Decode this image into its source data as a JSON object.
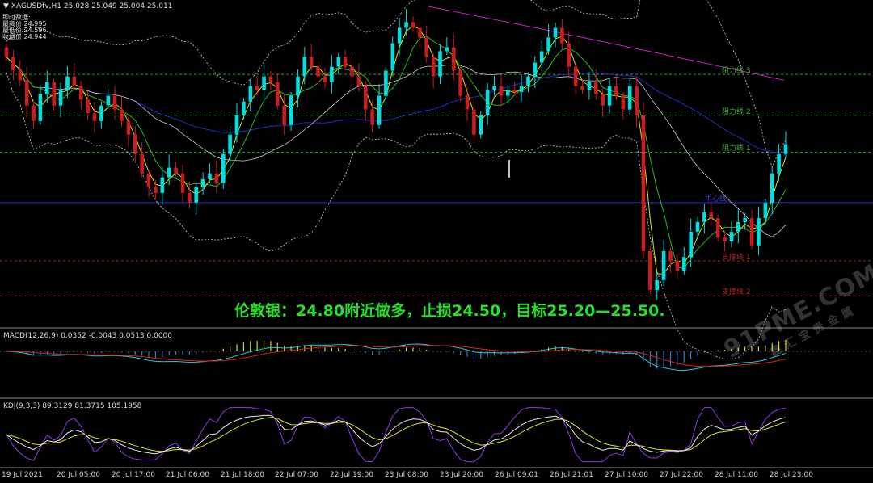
{
  "header": {
    "symbol_line": "XAGUSDfv,H1  25.028 25.049 25.004 25.011",
    "info_title": "即时数据:",
    "info_lines": [
      "最高价 24.995",
      "最低价 24.596",
      "收盘价 24.944"
    ]
  },
  "annotation": "伦敦银：24.80附近做多，止损24.50，目标25.20—25.50.",
  "levels": [
    {
      "label": "阻力线 3",
      "price": 25.46,
      "color": "#2fa82f"
    },
    {
      "label": "阻力线 2",
      "price": 25.25,
      "color": "#2fa82f"
    },
    {
      "label": "阻力线 1",
      "price": 25.06,
      "color": "#2fa82f"
    },
    {
      "label": "支撑线 1",
      "price": 24.5,
      "color": "#b22222"
    },
    {
      "label": "支撑线 2",
      "price": 24.32,
      "color": "#b22222"
    }
  ],
  "pivot": {
    "label": "中心线",
    "price": 24.8,
    "color": "#1f2fd8"
  },
  "macd": {
    "label": "MACD(12,26,9) 0.0352 -0.0043 0.0513 0.0000"
  },
  "kdj": {
    "label": "KDJ(9,3,3) 89.3129 81.3715 105.1958"
  },
  "time_axis": [
    "19 Jul 2021",
    "20 Jul 05:00",
    "20 Jul 17:00",
    "21 Jul 06:00",
    "21 Jul 18:00",
    "22 Jul 07:00",
    "22 Jul 19:00",
    "23 Jul 08:00",
    "23 Jul 20:00",
    "26 Jul 09:01",
    "26 Jul 21:01",
    "27 Jul 10:00",
    "27 Jul 22:00",
    "28 Jul 11:00",
    "28 Jul 23:00"
  ],
  "watermark": {
    "big": "91PME.COM",
    "small": "鑫汇宝贵金属"
  },
  "colors": {
    "bull": "#00e0e0",
    "bear": "#c81e1e",
    "ma_fast": "#e0e000",
    "ma_mid": "#22bb22",
    "ma_slow": "#1e2ec8",
    "ma_long": "#c020c0",
    "boll": "#cfcfcf"
  },
  "chart_data": {
    "type": "candlestick",
    "ylim": [
      24.18,
      25.81
    ],
    "closes": [
      25.55,
      25.48,
      25.43,
      25.3,
      25.22,
      25.36,
      25.42,
      25.3,
      25.38,
      25.45,
      25.4,
      25.33,
      25.26,
      25.22,
      25.3,
      25.35,
      25.28,
      25.22,
      25.15,
      25.05,
      24.95,
      24.88,
      24.85,
      24.93,
      24.98,
      24.95,
      24.85,
      24.8,
      24.88,
      24.92,
      24.95,
      24.9,
      25.05,
      25.15,
      25.25,
      25.32,
      25.4,
      25.38,
      25.45,
      25.42,
      25.3,
      25.2,
      25.35,
      25.45,
      25.55,
      25.5,
      25.45,
      25.42,
      25.5,
      25.55,
      25.5,
      25.45,
      25.4,
      25.28,
      25.2,
      25.35,
      25.48,
      25.62,
      25.7,
      25.73,
      25.7,
      25.65,
      25.55,
      25.45,
      25.58,
      25.6,
      25.48,
      25.35,
      25.28,
      25.15,
      25.25,
      25.38,
      25.4,
      25.35,
      25.38,
      25.37,
      25.4,
      25.45,
      25.52,
      25.58,
      25.65,
      25.7,
      25.62,
      25.5,
      25.4,
      25.38,
      25.42,
      25.36,
      25.3,
      25.4,
      25.35,
      25.28,
      25.4,
      25.25,
      24.55,
      24.35,
      24.4,
      24.55,
      24.5,
      24.45,
      24.52,
      24.65,
      24.7,
      24.75,
      24.72,
      24.62,
      24.6,
      24.65,
      24.7,
      24.72,
      24.58,
      24.72,
      24.8,
      24.95,
      25.05,
      25.1
    ]
  }
}
